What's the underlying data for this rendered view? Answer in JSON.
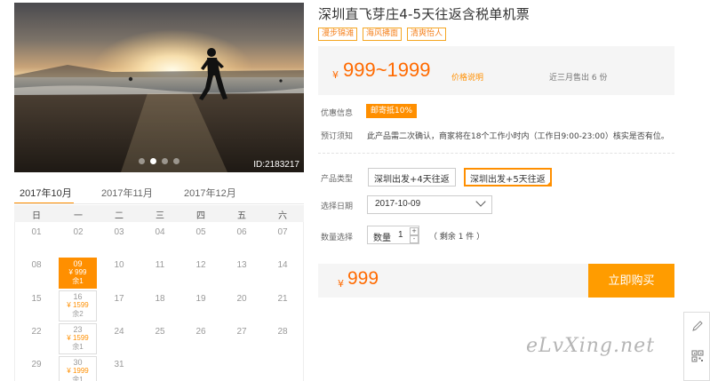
{
  "product": {
    "title": "深圳直飞芽庄4-5天往返含税单机票",
    "tags": [
      "漫步锦滩",
      "海风拂面",
      "清爽怡人"
    ],
    "photo_id": "ID:2183217",
    "photo_dots": 4,
    "photo_active_dot": 1
  },
  "price": {
    "currency": "¥",
    "range": "999~1999",
    "explain_link": "价格说明",
    "sold": "近三月售出 6 份"
  },
  "promo": {
    "label": "优惠信息",
    "badge": "邮寄抵10%"
  },
  "notice": {
    "label": "预订须知",
    "text": "此产品需二次确认，商家将在18个工作小时内（工作日9:00-23:00）核实是否有位。"
  },
  "type_select": {
    "label": "产品类型",
    "options": [
      "深圳出发+4天往返",
      "深圳出发+5天往返"
    ],
    "selected_index": 1
  },
  "date_select": {
    "label": "选择日期",
    "value": "2017-10-09"
  },
  "quantity": {
    "label": "数量选择",
    "field_label": "数量",
    "value": "1",
    "plus": "+",
    "minus": "-",
    "remaining": "（ 剩余 1 件 ）"
  },
  "total": {
    "currency": "¥",
    "value": "999"
  },
  "buy_button": "立即购买",
  "calendar": {
    "months": [
      "2017年10月",
      "2017年11月",
      "2017年12月"
    ],
    "active_month": 0,
    "weekdays": [
      "日",
      "一",
      "二",
      "三",
      "四",
      "五",
      "六"
    ],
    "rows": [
      [
        "01",
        "02",
        "03",
        "04",
        "05",
        "06",
        "07"
      ],
      [
        "08",
        "09",
        "10",
        "11",
        "12",
        "13",
        "14"
      ],
      [
        "15",
        "16",
        "17",
        "18",
        "19",
        "20",
        "21"
      ],
      [
        "22",
        "23",
        "24",
        "25",
        "26",
        "27",
        "28"
      ],
      [
        "29",
        "30",
        "31",
        "",
        "",
        "",
        ""
      ]
    ],
    "priced_days": [
      {
        "day": "09",
        "price": "¥ 999",
        "remain": "余1",
        "selected": true
      },
      {
        "day": "16",
        "price": "¥ 1599",
        "remain": "余2",
        "selected": false
      },
      {
        "day": "23",
        "price": "¥ 1599",
        "remain": "余1",
        "selected": false
      },
      {
        "day": "30",
        "price": "¥ 1999",
        "remain": "余1",
        "selected": false
      }
    ]
  },
  "watermark": "eLvXing.net",
  "colors": {
    "accent": "#ff8f00",
    "price": "#ff6a00",
    "button": "#ff9c00"
  },
  "icons": [
    "edit-icon",
    "qr-code-icon",
    "chevron-down-icon"
  ]
}
